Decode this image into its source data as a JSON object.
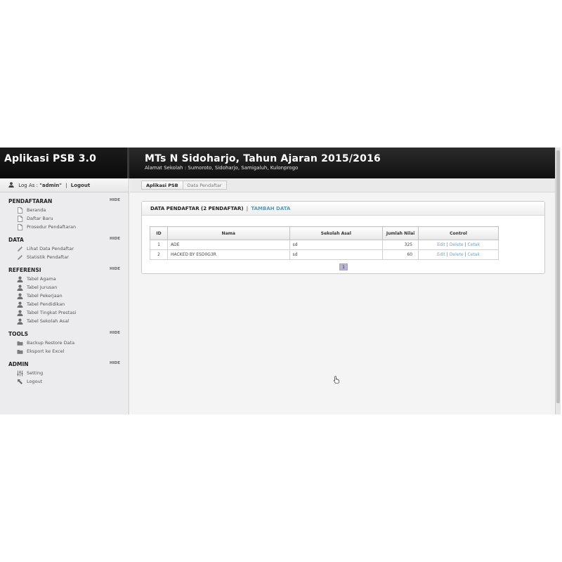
{
  "header": {
    "app_name": "Aplikasi PSB 3.0",
    "title": "MTs N Sidoharjo, Tahun Ajaran 2015/2016",
    "subtitle": "Alamat Sekolah : Sumoroto, Sidoharjo, Samigaluh, Kulonprogo"
  },
  "login": {
    "prefix": "Log As :",
    "user": "\"admin\"",
    "separator": "|",
    "logout": "Logout"
  },
  "sidebar": {
    "hide_label": "HIDE",
    "sections": [
      {
        "title": "PENDAFTARAN",
        "items": [
          {
            "label": "Beranda",
            "icon": "page-icon"
          },
          {
            "label": "Daftar Baru",
            "icon": "page-icon"
          },
          {
            "label": "Prosedur Pendaftaran",
            "icon": "page-icon"
          }
        ]
      },
      {
        "title": "DATA",
        "items": [
          {
            "label": "Lihat Data Pendaftar",
            "icon": "pencil-icon"
          },
          {
            "label": "Statistik Pendaftar",
            "icon": "pencil-icon"
          }
        ]
      },
      {
        "title": "REFERENSI",
        "items": [
          {
            "label": "Tabel Agama",
            "icon": "user-icon"
          },
          {
            "label": "Tabel Jurusan",
            "icon": "user-icon"
          },
          {
            "label": "Tabel Pekerjaan",
            "icon": "user-icon"
          },
          {
            "label": "Tabel Pendidikan",
            "icon": "user-icon"
          },
          {
            "label": "Tabel Tingkat Prestasi",
            "icon": "user-icon"
          },
          {
            "label": "Tabel Sekolah Asal",
            "icon": "user-icon"
          }
        ]
      },
      {
        "title": "TOOLS",
        "items": [
          {
            "label": "Backup Restore Data",
            "icon": "folder-icon"
          },
          {
            "label": "Eksport ke Excel",
            "icon": "folder-icon"
          }
        ]
      },
      {
        "title": "ADMIN",
        "items": [
          {
            "label": "Setting",
            "icon": "sliders-icon"
          },
          {
            "label": "Logout",
            "icon": "arrow-icon"
          }
        ]
      }
    ]
  },
  "breadcrumb": {
    "root": "Aplikasi PSB",
    "current": "Data Pendaftar"
  },
  "panel": {
    "title": "DATA PENDAFTAR (2 PENDAFTAR)",
    "separator": "|",
    "add_link": "TAMBAH DATA"
  },
  "table": {
    "columns": [
      "ID",
      "Nama",
      "Sekolah Asal",
      "Jumlah Nilai",
      "Control"
    ],
    "rows": [
      {
        "id": "1",
        "nama": "ADE",
        "sekolah": "sd",
        "nilai": "325"
      },
      {
        "id": "2",
        "nama": "HACKED BY ESD0G3R",
        "sekolah": "sd",
        "nilai": "60"
      }
    ],
    "actions": {
      "edit": "Edit",
      "delete": "Delete",
      "print": "Cetak",
      "separator": "|"
    }
  },
  "pagination": {
    "current_page": "1"
  },
  "colors": {
    "header_bg": "#141414",
    "sidebar_bg": "#ececee",
    "link": "#6fa3c0",
    "pager": "#b9b6cf"
  }
}
